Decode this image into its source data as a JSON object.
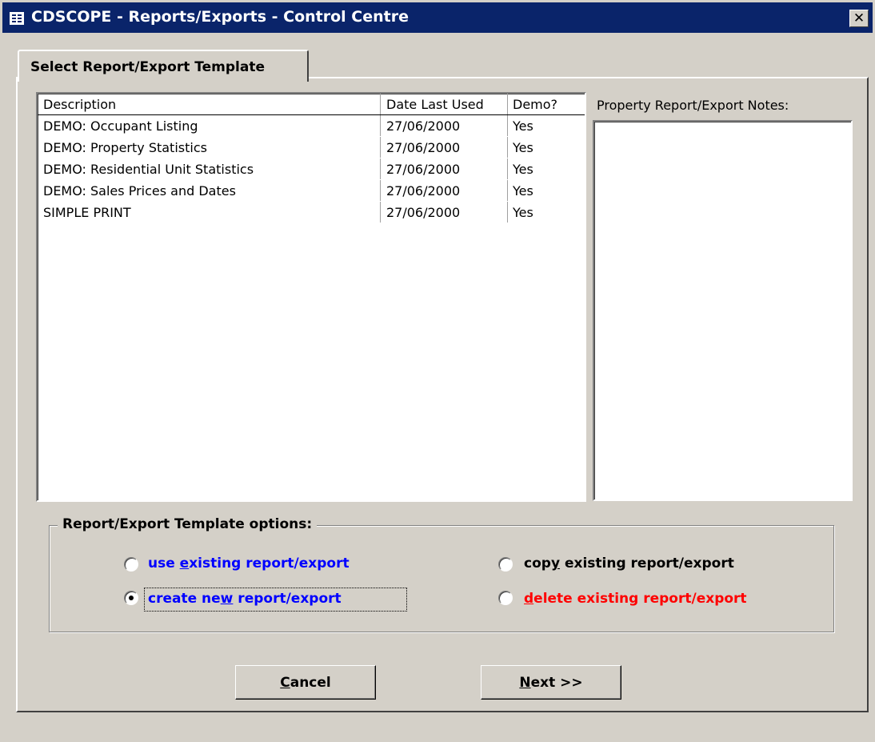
{
  "window": {
    "title": "CDSCOPE - Reports/Exports - Control Centre",
    "close_label": "✕"
  },
  "tab": {
    "label": "Select Report/Export Template"
  },
  "list": {
    "columns": [
      "Description",
      "Date Last Used",
      "Demo?"
    ],
    "rows": [
      [
        "DEMO: Occupant Listing",
        "27/06/2000",
        "Yes"
      ],
      [
        "DEMO: Property Statistics",
        "27/06/2000",
        "Yes"
      ],
      [
        "DEMO: Residential Unit Statistics",
        "27/06/2000",
        "Yes"
      ],
      [
        "DEMO: Sales Prices and Dates",
        "27/06/2000",
        "Yes"
      ],
      [
        "SIMPLE PRINT",
        "27/06/2000",
        "Yes"
      ]
    ]
  },
  "notes": {
    "label": "Property Report/Export Notes:"
  },
  "options": {
    "group_label": "Report/Export Template options:",
    "use_existing": {
      "pre": "use ",
      "key": "e",
      "post": "xisting report/export",
      "color": "#0000ff"
    },
    "create_new": {
      "pre": "create ne",
      "key": "w",
      "post": " report/export",
      "color": "#0000ff"
    },
    "copy_existing": {
      "pre": "cop",
      "key": "y",
      "post": " existing report/export",
      "color": "#000000"
    },
    "delete_existing": {
      "pre": "",
      "key": "d",
      "post": "elete existing report/export",
      "color": "#ff0000"
    },
    "selected": "create_new"
  },
  "buttons": {
    "cancel": {
      "key": "C",
      "rest": "ancel"
    },
    "next": {
      "key": "N",
      "rest": "ext >>"
    }
  }
}
